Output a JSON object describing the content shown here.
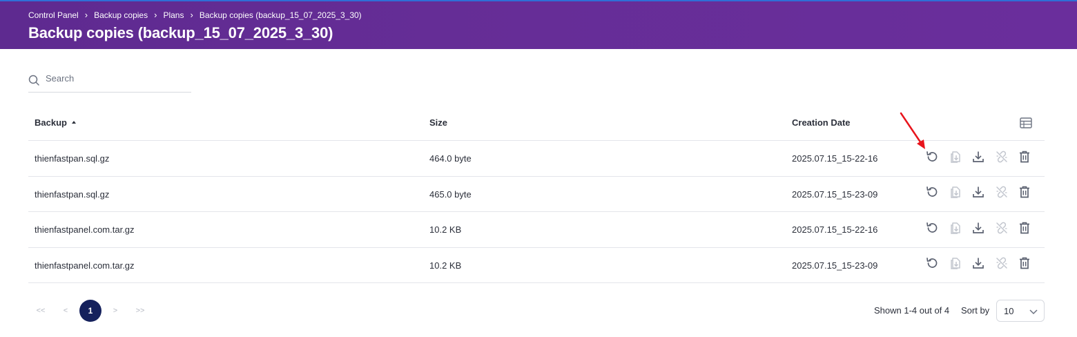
{
  "header": {
    "breadcrumb": [
      "Control Panel",
      "Backup copies",
      "Plans",
      "Backup copies (backup_15_07_2025_3_30)"
    ],
    "title": "Backup copies (backup_15_07_2025_3_30)"
  },
  "search": {
    "placeholder": "Search",
    "value": ""
  },
  "table": {
    "columns": {
      "backup": "Backup",
      "size": "Size",
      "date": "Creation Date"
    },
    "sorted_column": "Backup",
    "sort_direction": "ascending",
    "rows": [
      {
        "name": "thienfastpan.sql.gz",
        "size": "464.0 byte",
        "date": "2025.07.15_15-22-16"
      },
      {
        "name": "thienfastpan.sql.gz",
        "size": "465.0 byte",
        "date": "2025.07.15_15-23-09"
      },
      {
        "name": "thienfastpanel.com.tar.gz",
        "size": "10.2 KB",
        "date": "2025.07.15_15-22-16"
      },
      {
        "name": "thienfastpanel.com.tar.gz",
        "size": "10.2 KB",
        "date": "2025.07.15_15-23-09"
      }
    ],
    "row_actions": [
      "restore-icon",
      "extract-file-icon",
      "download-icon",
      "broken-link-icon",
      "trash-icon"
    ]
  },
  "pagination": {
    "first": "<<",
    "prev": "<",
    "current": "1",
    "next": ">",
    "last": ">>"
  },
  "footer": {
    "shown_text": "Shown 1-4 out of 4",
    "sort_by_label": "Sort by",
    "sort_by_value": "10"
  },
  "colors": {
    "header_bg": "#652d96",
    "accent": "#15215c",
    "annotation_arrow": "#e8141c"
  }
}
